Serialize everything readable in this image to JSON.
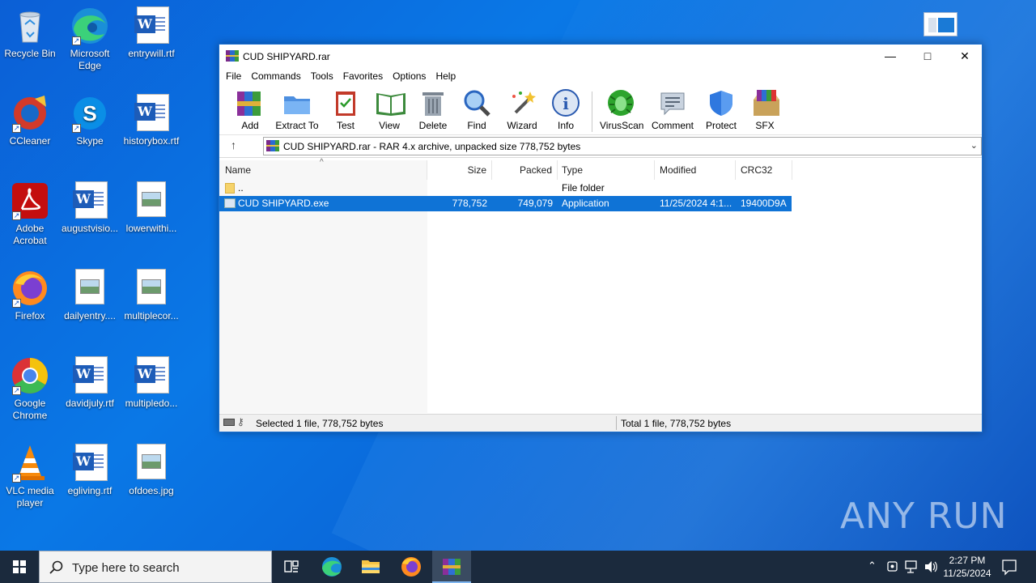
{
  "desktop": {
    "icons": [
      {
        "label": "Recycle Bin"
      },
      {
        "label": "Microsoft Edge"
      },
      {
        "label": "entrywill.rtf"
      },
      {
        "label": "CCleaner"
      },
      {
        "label": "Skype"
      },
      {
        "label": "historybox.rtf"
      },
      {
        "label": "Adobe Acrobat"
      },
      {
        "label": "augustvisio..."
      },
      {
        "label": "lowerwithi..."
      },
      {
        "label": "Firefox"
      },
      {
        "label": "dailyentry...."
      },
      {
        "label": "multiplecor..."
      },
      {
        "label": "Google Chrome"
      },
      {
        "label": "davidjuly.rtf"
      },
      {
        "label": "multipledo..."
      },
      {
        "label": "VLC media player"
      },
      {
        "label": "egliving.rtf"
      },
      {
        "label": "ofdoes.jpg"
      }
    ]
  },
  "window": {
    "title": "CUD SHIPYARD.rar",
    "menu": [
      "File",
      "Commands",
      "Tools",
      "Favorites",
      "Options",
      "Help"
    ],
    "toolbar": [
      "Add",
      "Extract To",
      "Test",
      "View",
      "Delete",
      "Find",
      "Wizard",
      "Info",
      "VirusScan",
      "Comment",
      "Protect",
      "SFX"
    ],
    "address": "CUD SHIPYARD.rar - RAR 4.x archive, unpacked size 778,752 bytes",
    "columns": [
      "Name",
      "Size",
      "Packed",
      "Type",
      "Modified",
      "CRC32"
    ],
    "rows": [
      {
        "name": "..",
        "size": "",
        "packed": "",
        "type": "File folder",
        "modified": "",
        "crc": ""
      },
      {
        "name": "CUD SHIPYARD.exe",
        "size": "778,752",
        "packed": "749,079",
        "type": "Application",
        "modified": "11/25/2024 4:1...",
        "crc": "19400D9A"
      }
    ],
    "status_left": "Selected 1 file, 778,752 bytes",
    "status_right": "Total 1 file, 778,752 bytes"
  },
  "taskbar": {
    "search_placeholder": "Type here to search",
    "time": "2:27 PM",
    "date": "11/25/2024"
  },
  "watermark": "ANY RUN",
  "colors": {
    "accent": "#0f73d6",
    "taskbar": "#1b2a3d"
  }
}
